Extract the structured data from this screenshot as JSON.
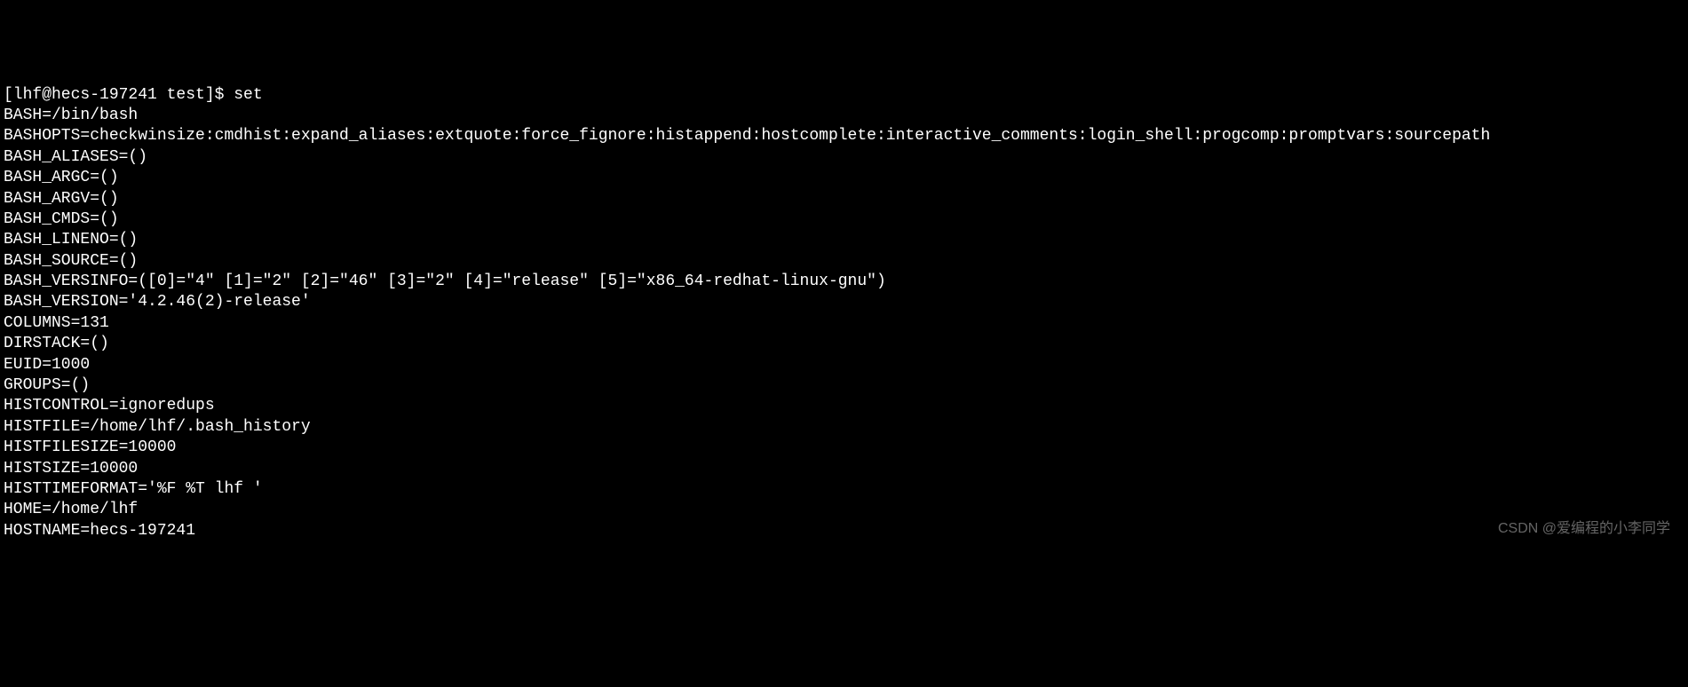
{
  "terminal": {
    "prompt": "[lhf@hecs-197241 test]$ ",
    "command": "set",
    "output_lines": [
      "BASH=/bin/bash",
      "BASHOPTS=checkwinsize:cmdhist:expand_aliases:extquote:force_fignore:histappend:hostcomplete:interactive_comments:login_shell:progcomp:promptvars:sourcepath",
      "BASH_ALIASES=()",
      "BASH_ARGC=()",
      "BASH_ARGV=()",
      "BASH_CMDS=()",
      "BASH_LINENO=()",
      "BASH_SOURCE=()",
      "BASH_VERSINFO=([0]=\"4\" [1]=\"2\" [2]=\"46\" [3]=\"2\" [4]=\"release\" [5]=\"x86_64-redhat-linux-gnu\")",
      "BASH_VERSION='4.2.46(2)-release'",
      "COLUMNS=131",
      "DIRSTACK=()",
      "EUID=1000",
      "GROUPS=()",
      "HISTCONTROL=ignoredups",
      "HISTFILE=/home/lhf/.bash_history",
      "HISTFILESIZE=10000",
      "HISTSIZE=10000",
      "HISTTIMEFORMAT='%F %T lhf '",
      "HOME=/home/lhf",
      "HOSTNAME=hecs-197241"
    ]
  },
  "watermark": "CSDN @爱编程的小李同学"
}
